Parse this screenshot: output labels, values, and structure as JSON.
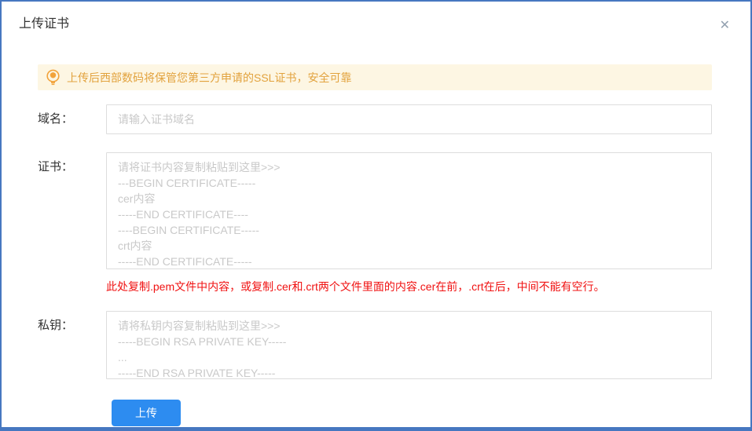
{
  "dialog": {
    "title": "上传证书"
  },
  "icons": {
    "close": "✕",
    "notice": "lightbulb-icon"
  },
  "notice": {
    "text": "上传后西部数码将保管您第三方申请的SSL证书，安全可靠"
  },
  "form": {
    "domain": {
      "label": "域名：",
      "value": "",
      "placeholder": "请输入证书域名"
    },
    "certificate": {
      "label": "证书：",
      "value": "",
      "placeholder": "请将证书内容复制粘贴到这里>>>\n---BEGIN CERTIFICATE-----\ncer内容\n-----END CERTIFICATE----\n----BEGIN CERTIFICATE-----\ncrt内容\n-----END CERTIFICATE-----",
      "hint": "此处复制.pem文件中内容，或复制.cer和.crt两个文件里面的内容.cer在前，.crt在后，中间不能有空行。"
    },
    "private_key": {
      "label": "私钥：",
      "value": "",
      "placeholder": "请将私钥内容复制粘贴到这里>>>\n-----BEGIN RSA PRIVATE KEY-----\n...\n-----END RSA PRIVATE KEY-----"
    },
    "submit_label": "上传"
  },
  "colors": {
    "border_blue": "#4677c0",
    "button_blue": "#2d8cf0",
    "notice_bg": "#fdf6e3",
    "notice_text": "#e2a23d",
    "icon_orange": "#f2a33c",
    "hint_red": "#f01212",
    "placeholder_gray": "#c9c9c9"
  }
}
